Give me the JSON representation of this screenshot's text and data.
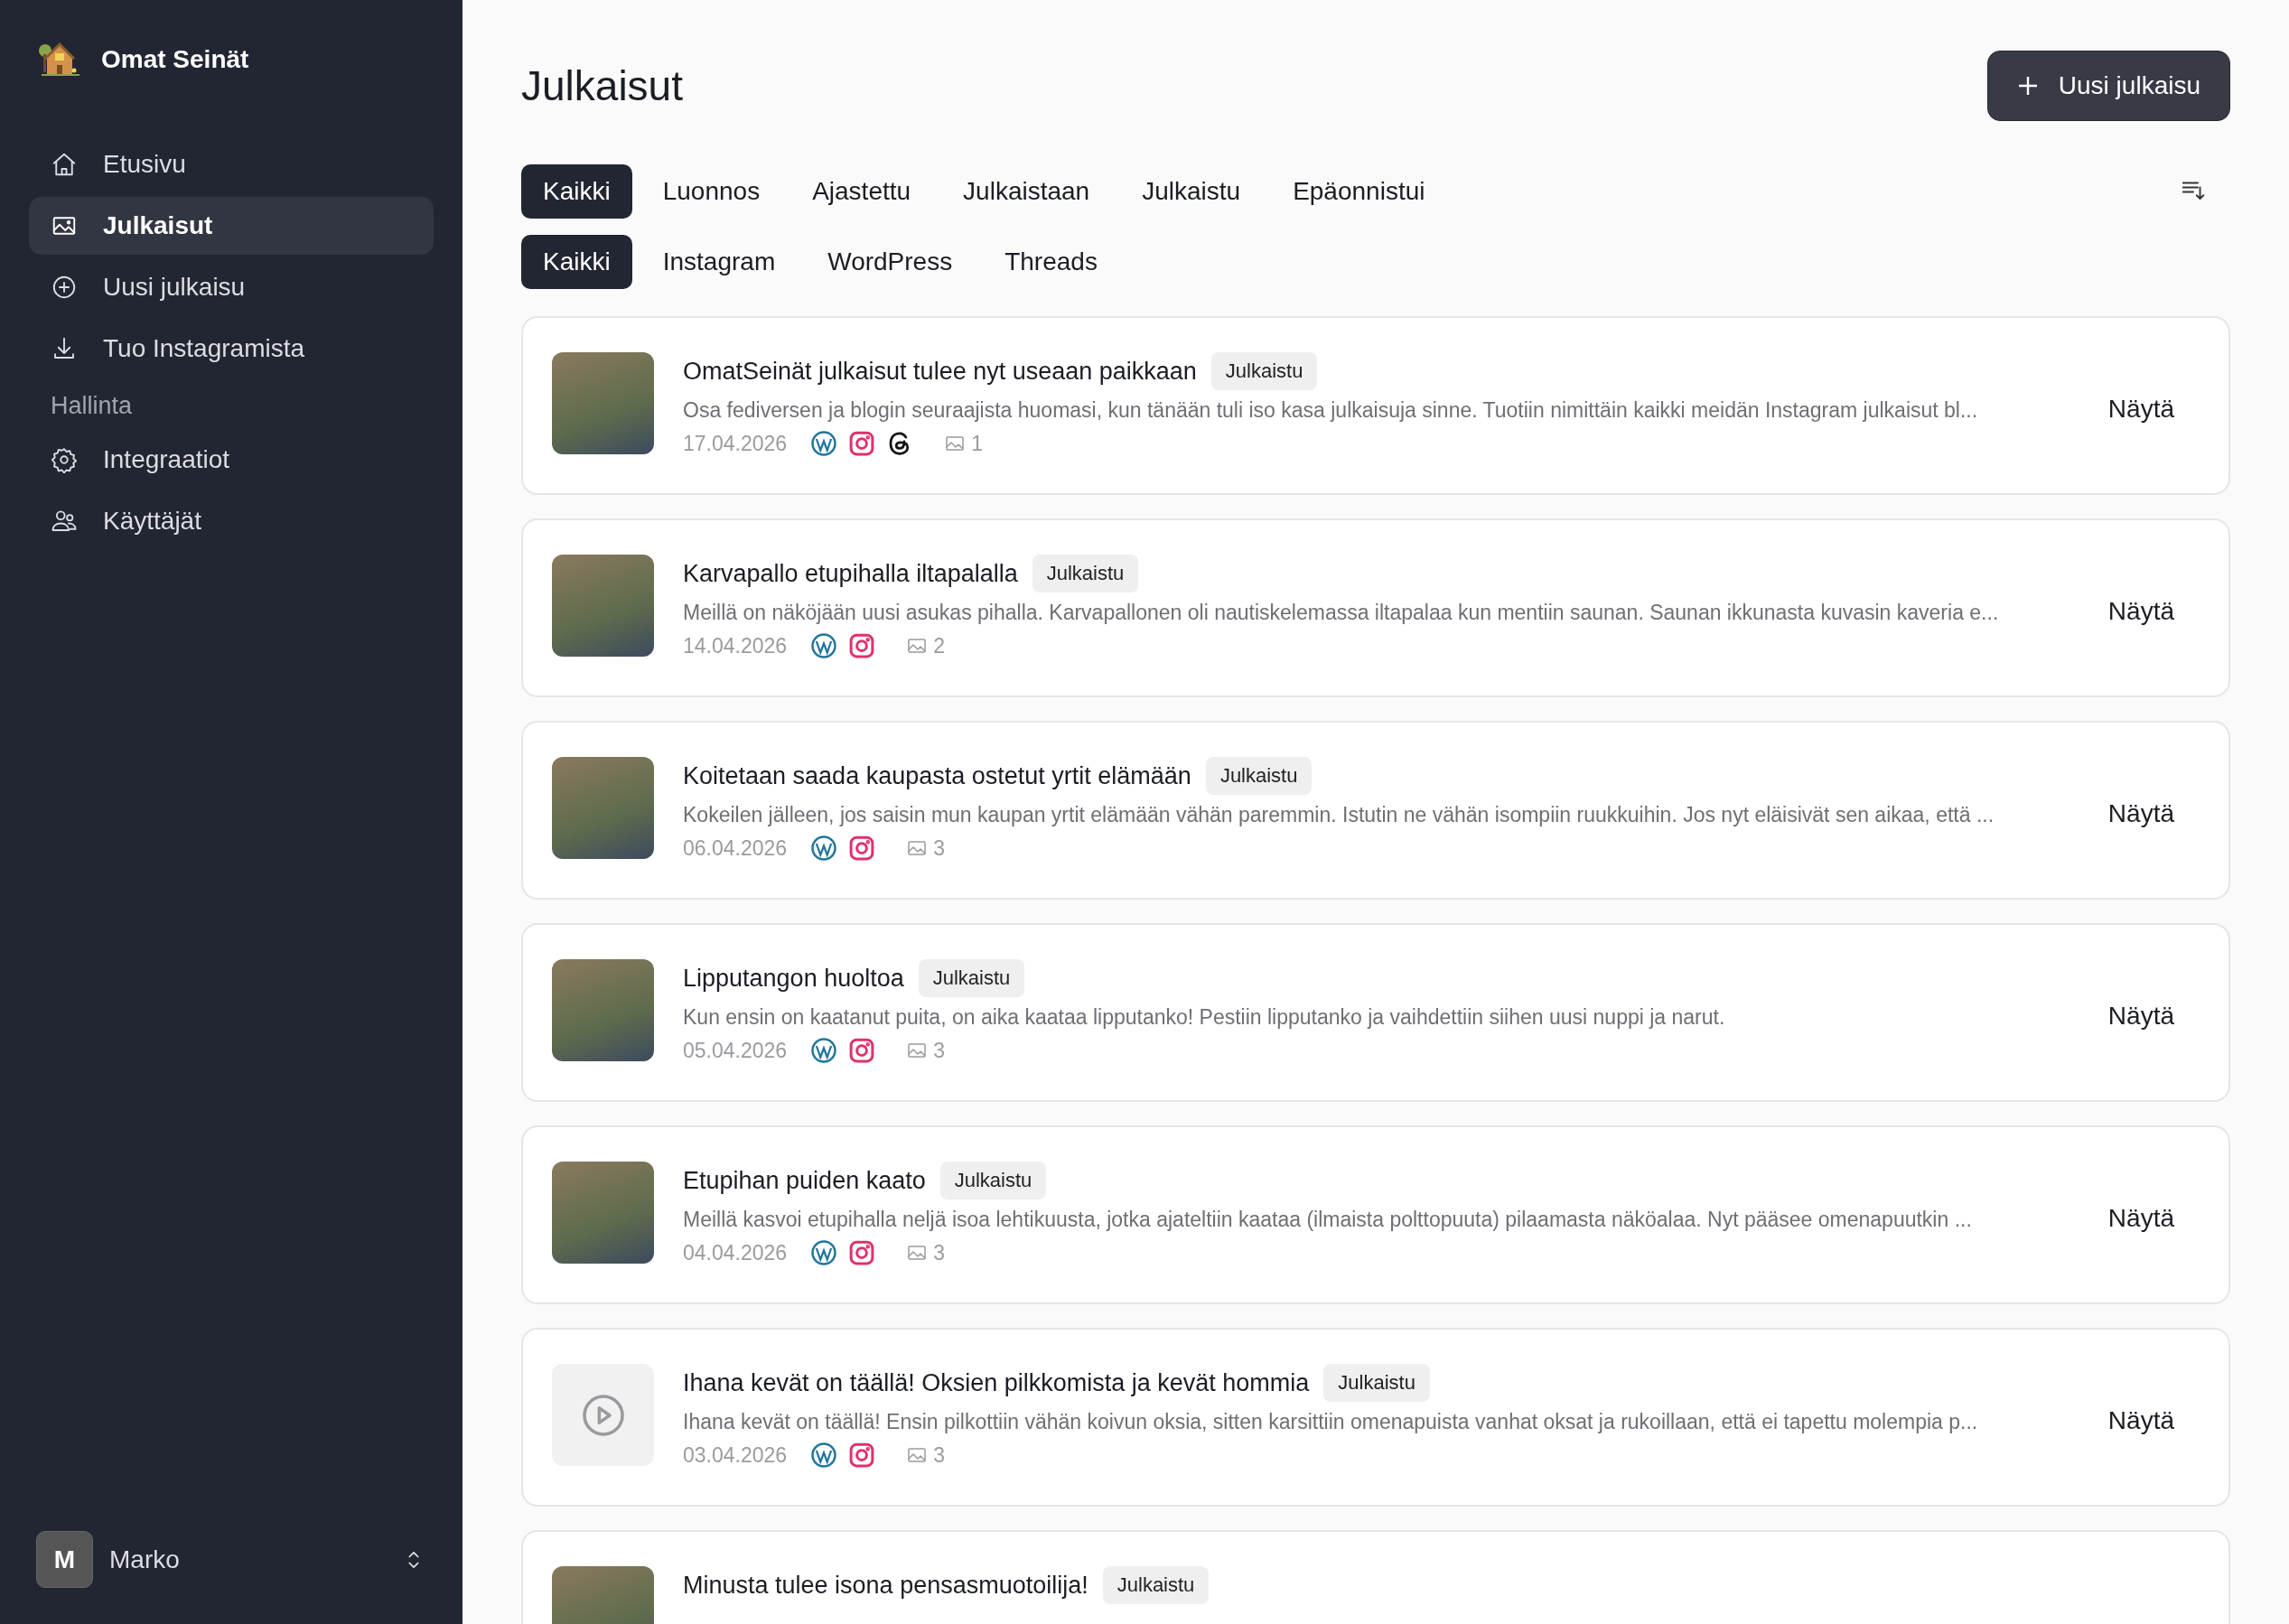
{
  "sidebar": {
    "brand": "Omat Seinät",
    "items": [
      {
        "label": "Etusivu",
        "kind": "home",
        "selected": false
      },
      {
        "label": "Julkaisut",
        "kind": "image",
        "selected": true
      },
      {
        "label": "Uusi julkaisu",
        "kind": "add",
        "selected": false
      },
      {
        "label": "Tuo Instagramista",
        "kind": "download",
        "selected": false
      }
    ],
    "section": "Hallinta",
    "section_items": [
      {
        "label": "Integraatiot",
        "kind": "settings",
        "selected": false
      },
      {
        "label": "Käyttäjät",
        "kind": "users",
        "selected": false
      }
    ],
    "user": {
      "initial": "M",
      "name": "Marko"
    }
  },
  "header": {
    "title": "Julkaisut",
    "new_button": "Uusi julkaisu"
  },
  "status_tabs": [
    {
      "label": "Kaikki",
      "selected": true
    },
    {
      "label": "Luonnos",
      "selected": false
    },
    {
      "label": "Ajastettu",
      "selected": false
    },
    {
      "label": "Julkaistaan",
      "selected": false
    },
    {
      "label": "Julkaistu",
      "selected": false
    },
    {
      "label": "Epäonnistui",
      "selected": false
    }
  ],
  "platform_tabs": [
    {
      "label": "Kaikki",
      "selected": true
    },
    {
      "label": "Instagram",
      "selected": false
    },
    {
      "label": "WordPress",
      "selected": false
    },
    {
      "label": "Threads",
      "selected": false
    }
  ],
  "posts": [
    {
      "kind": "photo",
      "title": "OmatSeinät julkaisut tulee nyt useaan paikkaan",
      "status": "Julkaistu",
      "excerpt": "Osa fediversen ja blogin seuraajista huomasi, kun tänään tuli iso kasa julkaisuja sinne. Tuotiin nimittäin kaikki meidän Instagram julkaisut bl...",
      "date": "17.04.2026",
      "platforms": [
        {
          "kind": "wordpress"
        },
        {
          "kind": "instagram"
        },
        {
          "kind": "threads"
        }
      ],
      "images": "1",
      "action": "Näytä"
    },
    {
      "kind": "photo",
      "title": "Karvapallo etupihalla iltapalalla",
      "status": "Julkaistu",
      "excerpt": "Meillä on näköjään uusi asukas pihalla. Karvapallonen oli nautiskelemassa iltapalaa kun mentiin saunan. Saunan ikkunasta kuvasin kaveria e...",
      "date": "14.04.2026",
      "platforms": [
        {
          "kind": "wordpress"
        },
        {
          "kind": "instagram"
        }
      ],
      "images": "2",
      "action": "Näytä"
    },
    {
      "kind": "photo",
      "title": "Koitetaan saada kaupasta ostetut yrtit elämään",
      "status": "Julkaistu",
      "excerpt": "Kokeilen jälleen, jos saisin mun kaupan yrtit elämään vähän paremmin. Istutin ne vähän isompiin ruukkuihin. Jos nyt eläisivät sen aikaa, että ...",
      "date": "06.04.2026",
      "platforms": [
        {
          "kind": "wordpress"
        },
        {
          "kind": "instagram"
        }
      ],
      "images": "3",
      "action": "Näytä"
    },
    {
      "kind": "photo",
      "title": "Lipputangon huoltoa",
      "status": "Julkaistu",
      "excerpt": "Kun ensin on kaatanut puita, on aika kaataa lipputanko! Pestiin lipputanko ja vaihdettiin siihen uusi nuppi ja narut.",
      "date": "05.04.2026",
      "platforms": [
        {
          "kind": "wordpress"
        },
        {
          "kind": "instagram"
        }
      ],
      "images": "3",
      "action": "Näytä"
    },
    {
      "kind": "photo",
      "title": "Etupihan puiden kaato",
      "status": "Julkaistu",
      "excerpt": "Meillä kasvoi etupihalla neljä isoa lehtikuusta, jotka ajateltiin kaataa (ilmaista polttopuuta) pilaamasta näköalaa. Nyt pääsee omenapuutkin ...",
      "date": "04.04.2026",
      "platforms": [
        {
          "kind": "wordpress"
        },
        {
          "kind": "instagram"
        }
      ],
      "images": "3",
      "action": "Näytä"
    },
    {
      "kind": "video",
      "title": "Ihana kevät on täällä! Oksien pilkkomista ja kevät hommia",
      "status": "Julkaistu",
      "excerpt": "Ihana kevät on täällä! Ensin pilkottiin vähän koivun oksia, sitten karsittiin omenapuista vanhat oksat ja rukoillaan, että ei tapettu molempia p...",
      "date": "03.04.2026",
      "platforms": [
        {
          "kind": "wordpress"
        },
        {
          "kind": "instagram"
        }
      ],
      "images": "3",
      "action": "Näytä"
    },
    {
      "kind": "photo",
      "title": "Minusta tulee isona pensasmuotoilija!",
      "status": "Julkaistu"
    }
  ]
}
